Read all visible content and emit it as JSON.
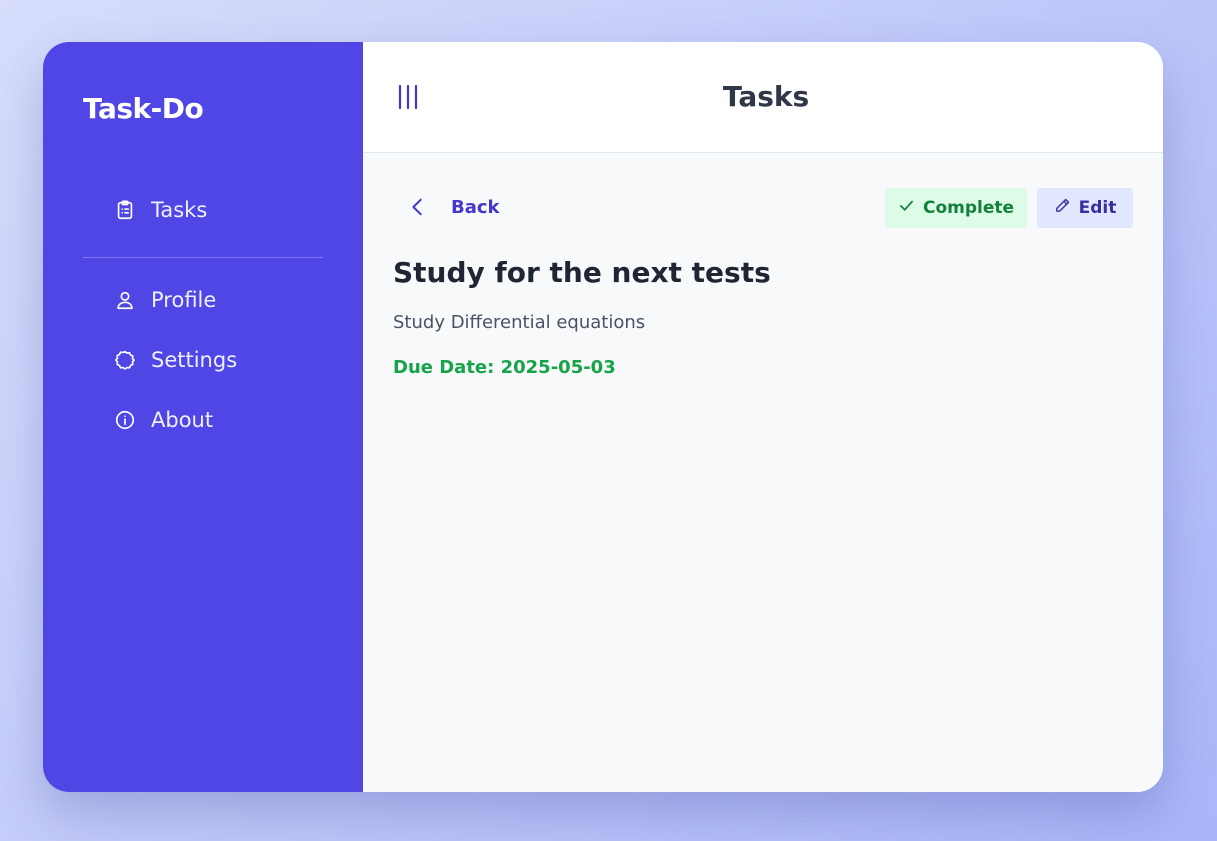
{
  "app": {
    "brand": "Task-Do"
  },
  "sidebar": {
    "items": [
      {
        "label": "Tasks",
        "icon": "clipboard-list-icon"
      },
      {
        "label": "Profile",
        "icon": "user-icon"
      },
      {
        "label": "Settings",
        "icon": "gear-icon"
      },
      {
        "label": "About",
        "icon": "info-icon"
      }
    ]
  },
  "header": {
    "title": "Tasks",
    "menu_icon": "menu-icon"
  },
  "toolbar": {
    "back_label": "Back",
    "complete_label": "Complete",
    "edit_label": "Edit"
  },
  "task": {
    "title": "Study for the next tests",
    "description": "Study Differential equations",
    "due_date": "Due Date: 2025-05-03"
  },
  "colors": {
    "sidebar_bg": "#4f46e5",
    "complete_bg": "#dcfce7",
    "complete_text": "#15803d",
    "edit_bg": "#e0e7ff",
    "edit_text": "#3730a3",
    "due_date_text": "#16a34a"
  }
}
